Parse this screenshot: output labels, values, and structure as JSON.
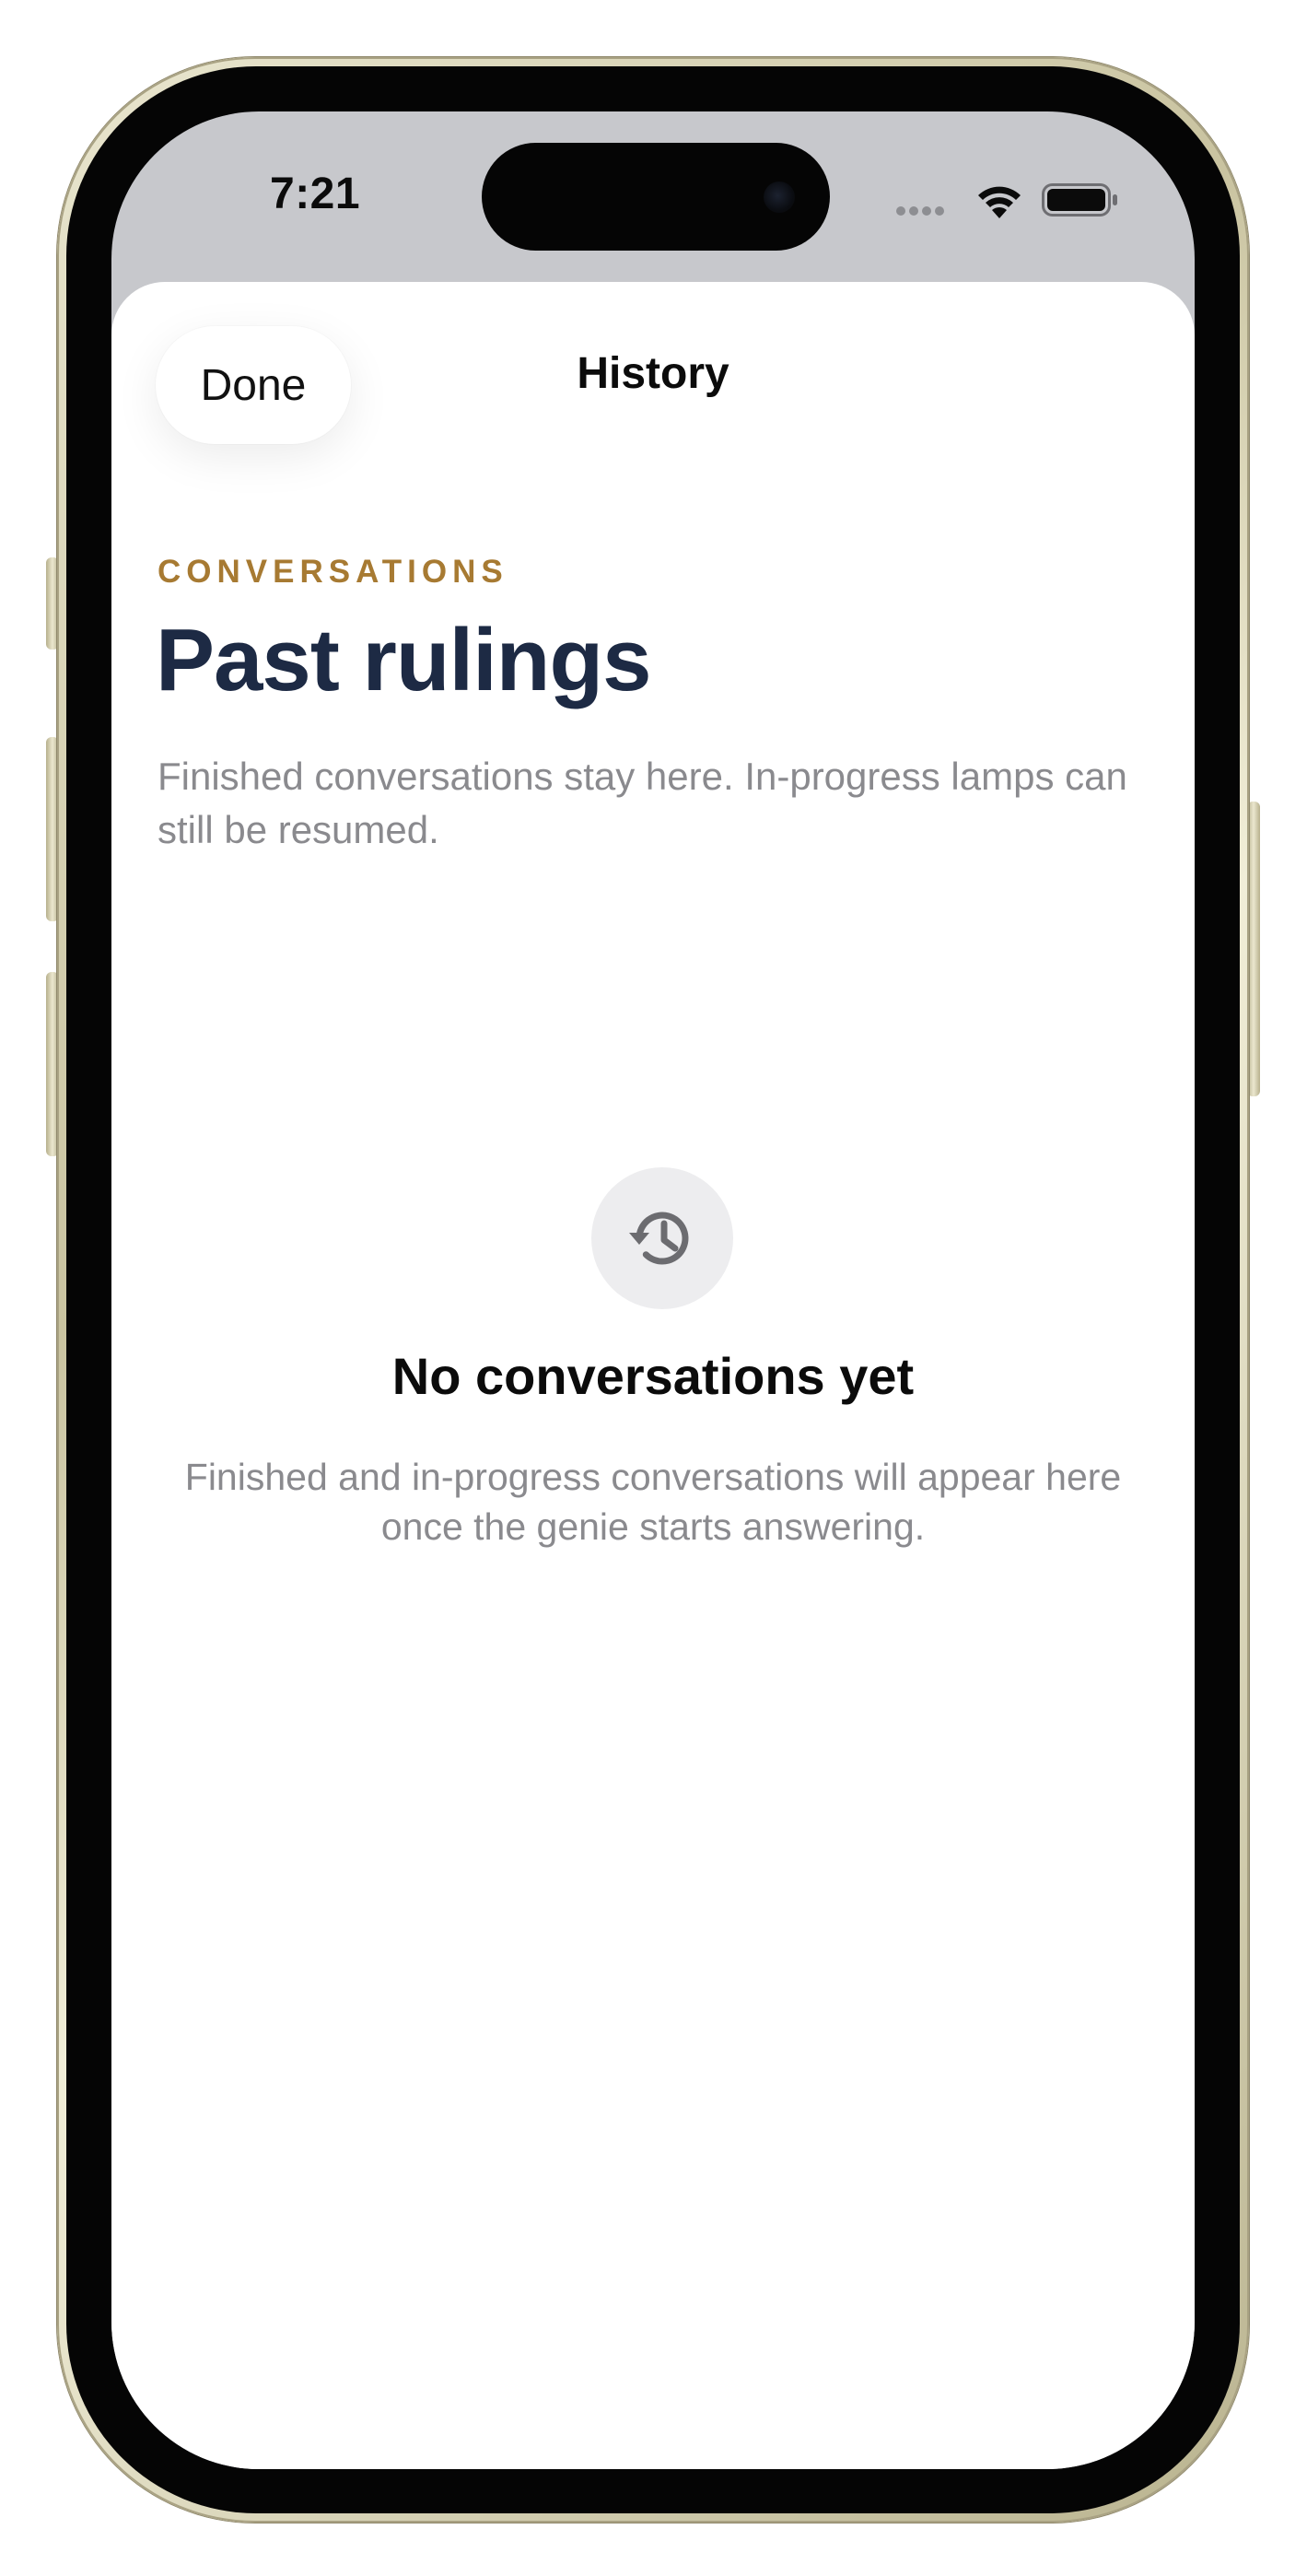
{
  "status_bar": {
    "time": "7:21"
  },
  "sheet": {
    "done_label": "Done",
    "title": "History"
  },
  "header": {
    "eyebrow": "CONVERSATIONS",
    "heading": "Past rulings",
    "subtitle": "Finished conversations stay here. In-progress lamps can still be resumed."
  },
  "empty_state": {
    "icon": "history-icon",
    "title": "No conversations yet",
    "body": "Finished and in-progress conversations will appear here once the genie starts answering."
  },
  "colors": {
    "eyebrow": "#a77a32",
    "heading": "#1d2a44",
    "muted": "#8a8a8e",
    "icon_bg": "#ededef",
    "status_area": "#c7c8cc"
  }
}
